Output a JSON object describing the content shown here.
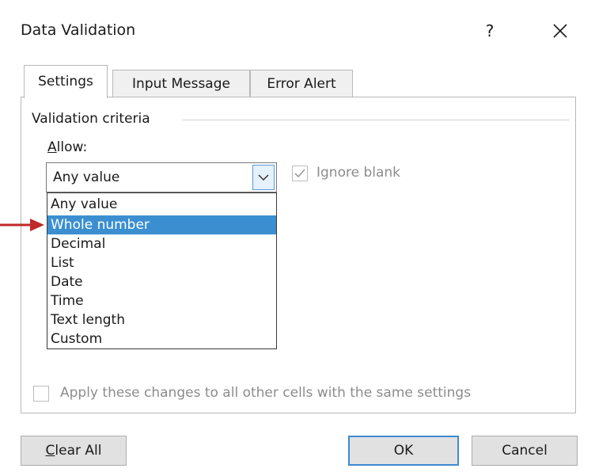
{
  "dialog": {
    "title": "Data Validation",
    "help_label": "?",
    "close_label": "✕"
  },
  "tabs": [
    {
      "label": "Settings",
      "active": true
    },
    {
      "label": "Input Message",
      "active": false
    },
    {
      "label": "Error Alert",
      "active": false
    }
  ],
  "settings": {
    "group_label": "Validation criteria",
    "allow_label_first": "A",
    "allow_label_rest": "llow:",
    "allow_value": "Any value",
    "allow_options": [
      "Any value",
      "Whole number",
      "Decimal",
      "List",
      "Date",
      "Time",
      "Text length",
      "Custom"
    ],
    "highlighted_option": "Whole number",
    "ignore_blank_label": "Ignore blank",
    "ignore_blank_checked": true,
    "apply_all_label": "Apply these changes to all other cells with the same settings",
    "apply_all_checked": false
  },
  "buttons": {
    "clear_all_first": "C",
    "clear_all_rest": "lear All",
    "ok": "OK",
    "cancel": "Cancel"
  },
  "colors": {
    "accent": "#3b8fd0",
    "annotation_arrow": "#c0282a"
  },
  "icons": {
    "dropdown": "chevron-down-icon",
    "close": "close-icon",
    "annotation": "arrow-right-icon"
  }
}
